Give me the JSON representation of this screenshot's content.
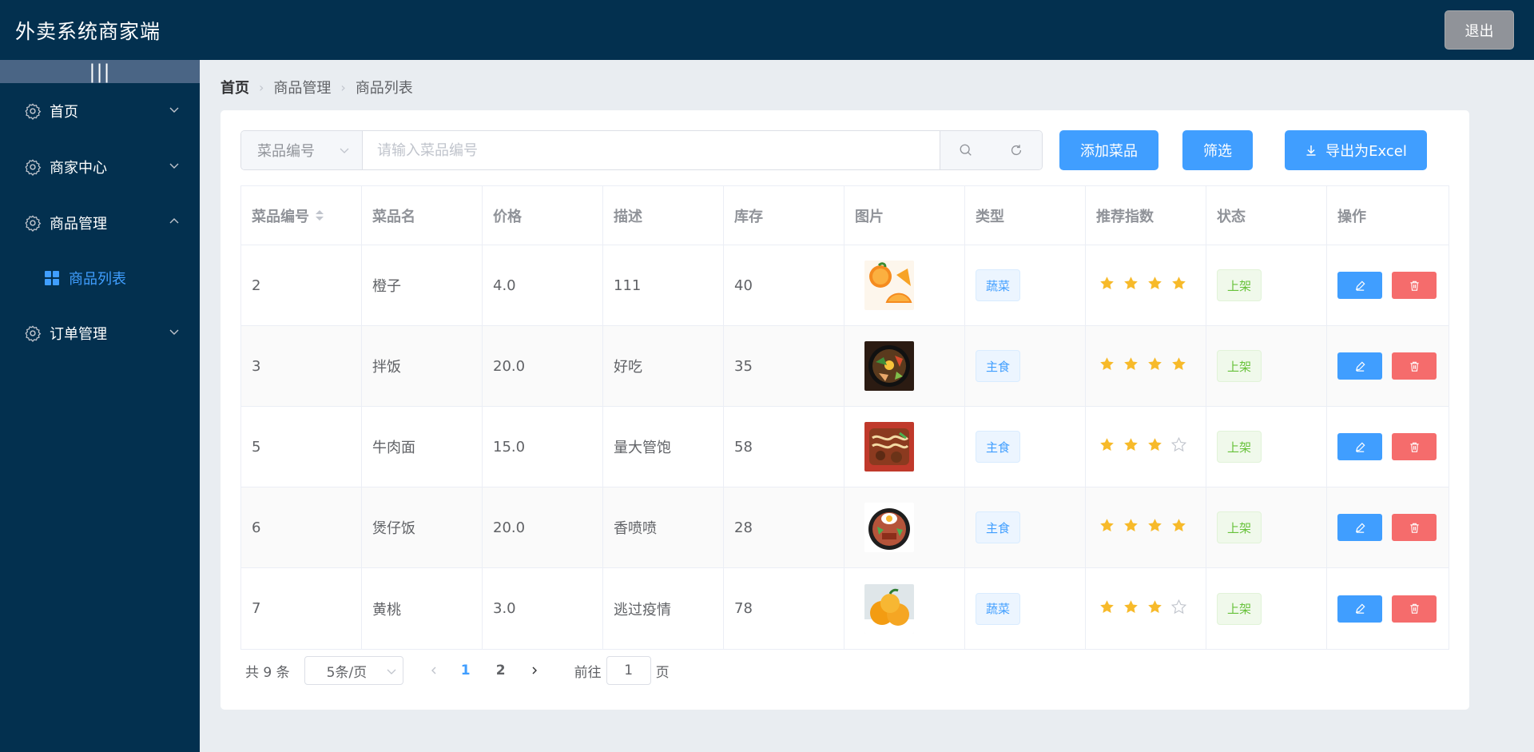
{
  "app": {
    "title": "外卖系统商家端",
    "logout_label": "退出"
  },
  "sidebar": {
    "collapse_glyph": "|||",
    "items": [
      {
        "label": "首页",
        "expanded": false
      },
      {
        "label": "商家中心",
        "expanded": false
      },
      {
        "label": "商品管理",
        "expanded": true,
        "children": [
          {
            "label": "商品列表",
            "active": true
          }
        ]
      },
      {
        "label": "订单管理",
        "expanded": false
      }
    ]
  },
  "breadcrumb": [
    "首页",
    "商品管理",
    "商品列表"
  ],
  "toolbar": {
    "search_field": "菜品编号",
    "search_placeholder": "请输入菜品编号",
    "add_label": "添加菜品",
    "filter_label": "筛选",
    "export_label": "导出为Excel"
  },
  "table": {
    "columns": [
      "菜品编号",
      "菜品名",
      "价格",
      "描述",
      "库存",
      "图片",
      "类型",
      "推荐指数",
      "状态",
      "操作"
    ],
    "rows": [
      {
        "id": "2",
        "name": "橙子",
        "price": "4.0",
        "desc": "111",
        "stock": "40",
        "image": "orange",
        "type": "蔬菜",
        "rating": 4,
        "status": "上架"
      },
      {
        "id": "3",
        "name": "拌饭",
        "price": "20.0",
        "desc": "好吃",
        "stock": "35",
        "image": "bibimbap",
        "type": "主食",
        "rating": 4,
        "status": "上架"
      },
      {
        "id": "5",
        "name": "牛肉面",
        "price": "15.0",
        "desc": "量大管饱",
        "stock": "58",
        "image": "beef-noodles",
        "type": "主食",
        "rating": 3,
        "status": "上架"
      },
      {
        "id": "6",
        "name": "煲仔饭",
        "price": "20.0",
        "desc": "香喷喷",
        "stock": "28",
        "image": "claypot-rice",
        "type": "主食",
        "rating": 4,
        "status": "上架"
      },
      {
        "id": "7",
        "name": "黄桃",
        "price": "3.0",
        "desc": "逃过疫情",
        "stock": "78",
        "image": "yellow-peach",
        "type": "蔬菜",
        "rating": 3,
        "status": "上架"
      }
    ]
  },
  "pagination": {
    "total_text": "共 9 条",
    "page_size": "5条/页",
    "pages": [
      "1",
      "2"
    ],
    "current": "1",
    "goto_label": "前往",
    "goto_value": "1",
    "page_suffix": "页"
  },
  "colors": {
    "primary": "#409eff",
    "danger": "#f56c6c",
    "success": "#67c23a",
    "header": "#03304f",
    "star": "#f7ba2a"
  },
  "icons": [
    "gear-icon",
    "chevron-down-icon",
    "chevron-up-icon",
    "grid-icon",
    "search-icon",
    "refresh-icon",
    "download-icon",
    "edit-icon",
    "delete-icon",
    "star-icon",
    "sort-icon"
  ]
}
